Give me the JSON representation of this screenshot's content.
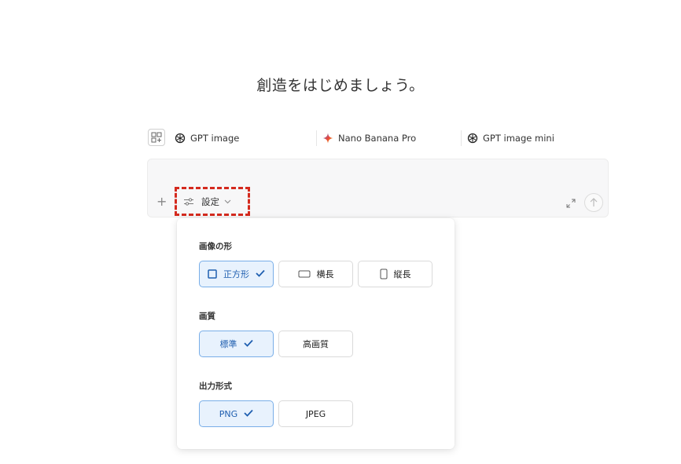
{
  "heading": "創造をはじめましょう。",
  "models": [
    {
      "label": "GPT image",
      "icon": "openai-icon"
    },
    {
      "label": "Nano Banana Pro",
      "icon": "gemini-sparkle-icon"
    },
    {
      "label": "GPT image mini",
      "icon": "openai-icon"
    }
  ],
  "composer": {
    "settings_label": "設定"
  },
  "panel": {
    "shape": {
      "label": "画像の形",
      "options": [
        {
          "label": "正方形",
          "selected": true
        },
        {
          "label": "横長",
          "selected": false
        },
        {
          "label": "縦長",
          "selected": false
        }
      ]
    },
    "quality": {
      "label": "画質",
      "options": [
        {
          "label": "標準",
          "selected": true
        },
        {
          "label": "高画質",
          "selected": false
        }
      ]
    },
    "format": {
      "label": "出力形式",
      "options": [
        {
          "label": "PNG",
          "selected": true
        },
        {
          "label": "JPEG",
          "selected": false
        }
      ]
    }
  },
  "colors": {
    "highlight_border": "#d42a1e",
    "selected_bg": "#e8f2fd",
    "selected_border": "#79aee8",
    "accent": "#1f5fb0"
  }
}
